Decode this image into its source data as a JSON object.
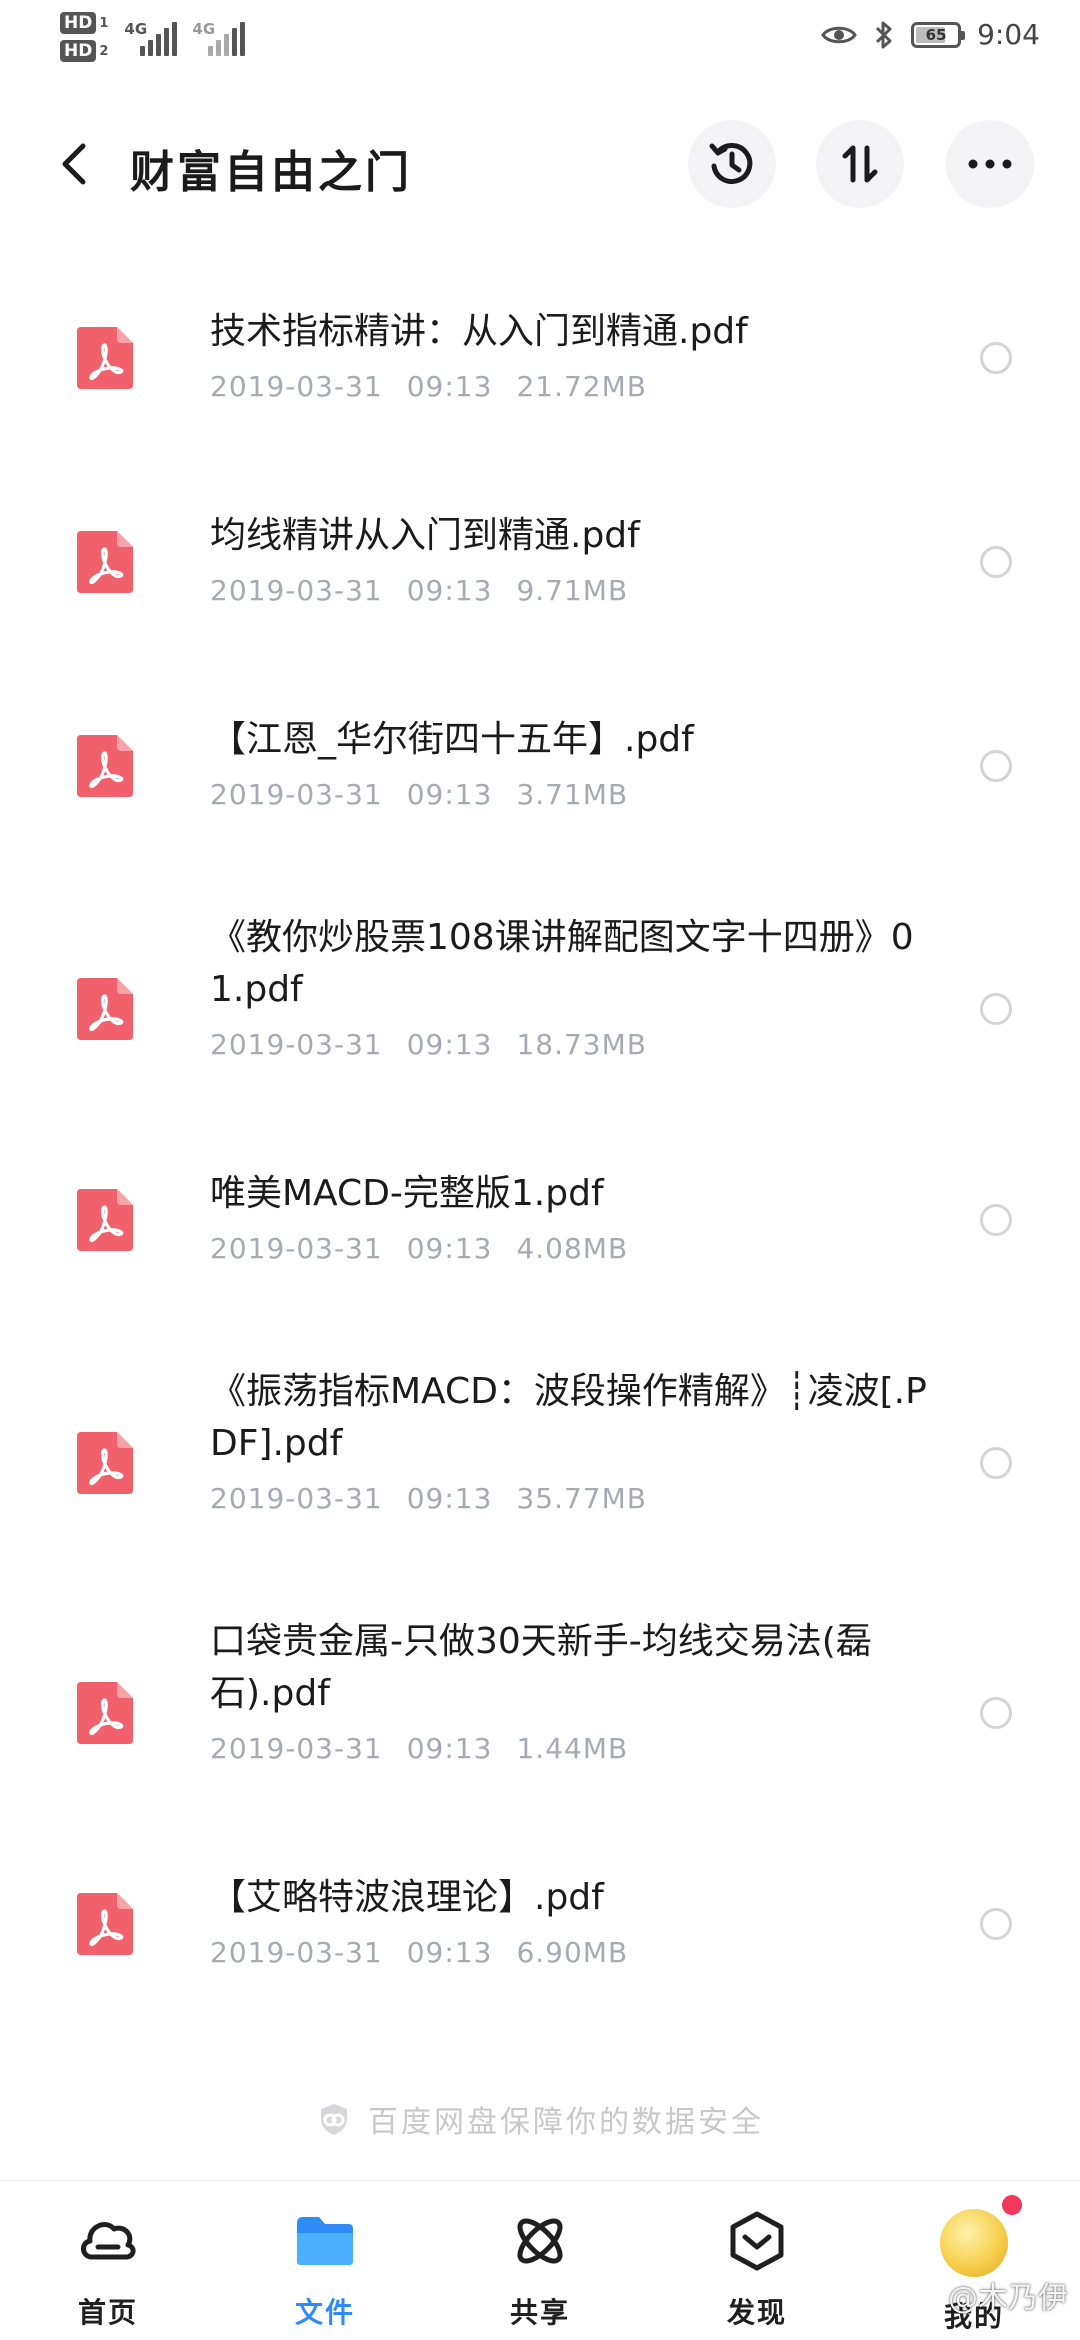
{
  "status_bar": {
    "hd1": "HD",
    "hd1_num": "1",
    "hd2": "HD",
    "hd2_num": "2",
    "net1": "4G",
    "net2": "4G",
    "battery": "65",
    "battery_level": 0.65,
    "time": "9:04"
  },
  "header": {
    "title": "财富自由之门",
    "icons": [
      "back-arrow",
      "history",
      "sort",
      "more"
    ]
  },
  "files": [
    {
      "name": "技术指标精讲：从入门到精通.pdf",
      "date": "2019-03-31",
      "time": "09:13",
      "size": "21.72MB"
    },
    {
      "name": "均线精讲从入门到精通.pdf",
      "date": "2019-03-31",
      "time": "09:13",
      "size": "9.71MB"
    },
    {
      "name": "【江恩_华尔街四十五年】.pdf",
      "date": "2019-03-31",
      "time": "09:13",
      "size": "3.71MB"
    },
    {
      "name": "《教你炒股票108课讲解配图文字十四册》01.pdf",
      "date": "2019-03-31",
      "time": "09:13",
      "size": "18.73MB"
    },
    {
      "name": "唯美MACD-完整版1.pdf",
      "date": "2019-03-31",
      "time": "09:13",
      "size": "4.08MB"
    },
    {
      "name": "《振荡指标MACD：波段操作精解》┊凌波[.PDF].pdf",
      "date": "2019-03-31",
      "time": "09:13",
      "size": "35.77MB"
    },
    {
      "name": "口袋贵金属-只做30天新手-均线交易法(磊石).pdf",
      "date": "2019-03-31",
      "time": "09:13",
      "size": "1.44MB"
    },
    {
      "name": "【艾略特波浪理论】.pdf",
      "date": "2019-03-31",
      "time": "09:13",
      "size": "6.90MB"
    }
  ],
  "footer_note": "百度网盘保障你的数据安全",
  "nav": {
    "home": "首页",
    "files": "文件",
    "share": "共享",
    "discover": "发现",
    "mine": "我的"
  },
  "watermark": "@木乃伊",
  "colors": {
    "pdf_icon": "#f0616b",
    "active_tab": "#2f8cf7",
    "meta_text": "#a6abb3",
    "notification_dot": "#f2375a"
  }
}
